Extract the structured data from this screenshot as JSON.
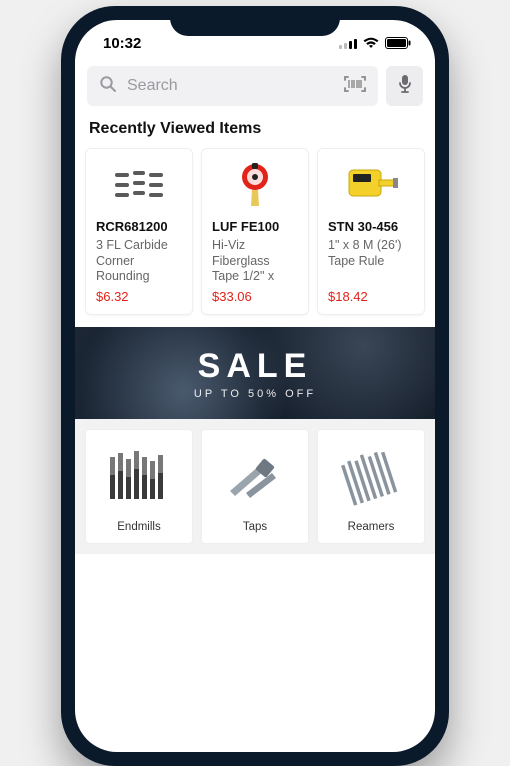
{
  "status": {
    "time": "10:32"
  },
  "search": {
    "placeholder": "Search"
  },
  "recent": {
    "title": "Recently Viewed Items",
    "items": [
      {
        "sku": "RCR681200",
        "desc": "3 FL Carbide Corner Rounding",
        "price": "$6.32"
      },
      {
        "sku": "LUF FE100",
        "desc": "Hi-Viz Fiberglass Tape 1/2\" x",
        "price": "$33.06"
      },
      {
        "sku": "STN 30-456",
        "desc": "1\" x 8 M (26') Tape Rule",
        "price": "$18.42"
      }
    ]
  },
  "sale": {
    "headline": "SALE",
    "sub": "UP TO 50% OFF"
  },
  "categories": [
    {
      "label": "Endmills"
    },
    {
      "label": "Taps"
    },
    {
      "label": "Reamers"
    }
  ]
}
